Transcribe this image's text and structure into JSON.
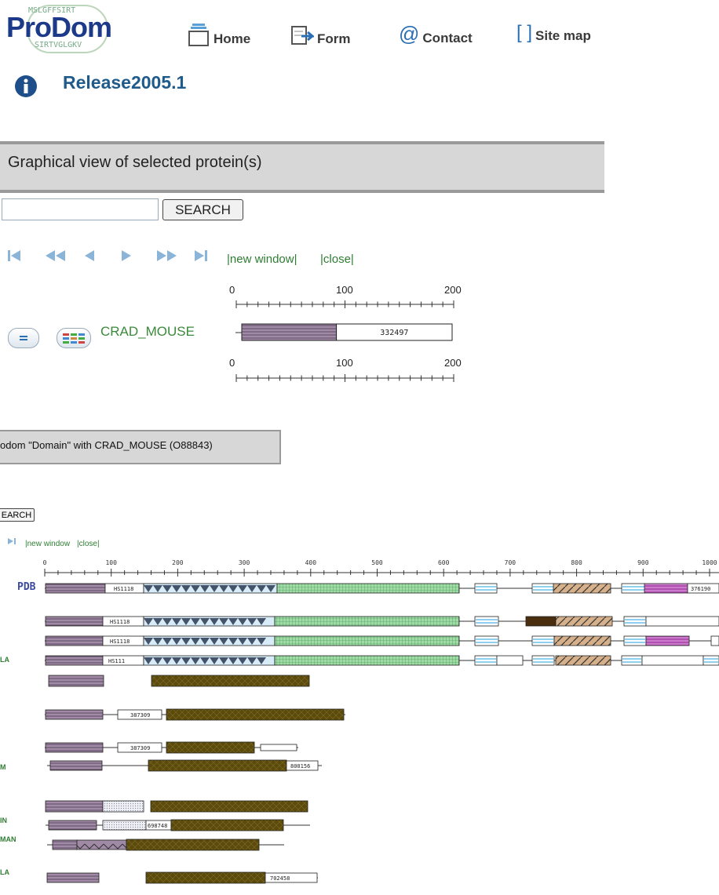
{
  "header": {
    "logo_text": "ProDom",
    "logo_top_seq": "MSLGFFSIRT",
    "logo_bottom_seq": "SIRTVGLGKV",
    "nav": [
      {
        "label": "Home",
        "icon": "home-icon"
      },
      {
        "label": "Form",
        "icon": "form-icon"
      },
      {
        "label": "Contact",
        "icon": "at-icon"
      },
      {
        "label": "Site map",
        "icon": "brackets-icon"
      }
    ]
  },
  "release": {
    "label": "Release2005.1",
    "icon": "info-icon"
  },
  "main": {
    "title": "Graphical view of selected protein(s)",
    "search": {
      "value": "",
      "placeholder": "",
      "button_label": "SEARCH"
    },
    "pager_icons": [
      "first-icon",
      "fast-back-icon",
      "prev-icon",
      "next-icon",
      "fast-forward-icon",
      "last-icon"
    ],
    "link_new_window": "|new window|",
    "link_close": "|close|",
    "scale": {
      "min": "0",
      "mid": "100",
      "max": "200"
    },
    "protein": {
      "name": "CRAD_MOUSE",
      "domain_label": "332497",
      "domain1_end": 90,
      "length": 200
    }
  },
  "second": {
    "title": "odom \"Domain\" with CRAD_MOUSE (O88843)",
    "search_label": "EARCH",
    "link_new_window": "|new window",
    "link_close": "|close|",
    "scale_ticks": [
      "0",
      "100",
      "200",
      "300",
      "400",
      "500",
      "600",
      "700",
      "800",
      "900",
      "1000"
    ],
    "pdb_label": "PDB",
    "row_labels": [
      "LA",
      "M",
      "IN",
      "MAN",
      "LA"
    ],
    "domain_labels": [
      "HS1118",
      "376190",
      "HS1118",
      "HS1118",
      "HS111",
      "387309",
      "387309",
      "800156",
      "698748",
      "702458"
    ]
  },
  "colors": {
    "purple_domain": "#a08aa6",
    "white_domain": "#ffffff",
    "olive_domain": "#5a4a0c",
    "green_grid": "#9edba5",
    "tan_hatch": "#d5b08a",
    "magenta": "#b050b0",
    "light_blue": "#8fd0ef"
  }
}
